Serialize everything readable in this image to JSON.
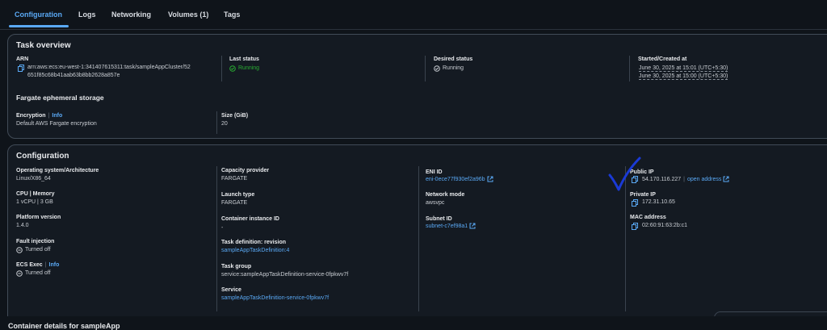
{
  "tabs": [
    "Configuration",
    "Logs",
    "Networking",
    "Volumes (1)",
    "Tags"
  ],
  "task_overview": {
    "title": "Task overview",
    "arn_label": "ARN",
    "arn_line1": "arn:aws:ecs:eu-west-1:341407615311:task/sampleAppCluster/52",
    "arn_line2": "651f85c68b41aab63b8bb2628a857e",
    "last_status_label": "Last status",
    "last_status_value": "Running",
    "desired_status_label": "Desired status",
    "desired_status_value": "Running",
    "started_label": "Started/Created at",
    "started_value": "June 30, 2025 at 15:01 (UTC+5:30)",
    "created_value": "June 30, 2025 at 15:00 (UTC+5:30)",
    "storage_title": "Fargate ephemeral storage",
    "encryption_label": "Encryption",
    "info": "Info",
    "encryption_value": "Default AWS Fargate encryption",
    "size_label": "Size (GiB)",
    "size_value": "20"
  },
  "configuration": {
    "title": "Configuration",
    "os_label": "Operating system/Architecture",
    "os_value": "Linux/X86_64",
    "cpu_label": "CPU | Memory",
    "cpu_value": "1 vCPU | 3 GB",
    "platform_label": "Platform version",
    "platform_value": "1.4.0",
    "fault_label": "Fault injection",
    "fault_value": "Turned off",
    "ecs_exec_label": "ECS Exec",
    "info": "Info",
    "ecs_exec_value": "Turned off",
    "capacity_label": "Capacity provider",
    "capacity_value": "FARGATE",
    "launch_label": "Launch type",
    "launch_value": "FARGATE",
    "container_instance_label": "Container instance ID",
    "container_instance_value": "-",
    "taskdef_label": "Task definition: revision",
    "taskdef_value": "sampleAppTaskDefinition:4",
    "taskgroup_label": "Task group",
    "taskgroup_value": "service:sampleAppTaskDefinition-service-0fpkwv7f",
    "service_label": "Service",
    "service_value": "sampleAppTaskDefinition-service-0fpkwv7f",
    "eni_label": "ENI ID",
    "eni_value": "eni-0ece77f930ef2a96b",
    "netmode_label": "Network mode",
    "netmode_value": "awsvpc",
    "subnet_label": "Subnet ID",
    "subnet_value": "subnet-c7ef98a1",
    "public_ip_label": "Public IP",
    "public_ip_value": "54.170.116.227",
    "open_address": "open address",
    "private_ip_label": "Private IP",
    "private_ip_value": "172.31.10.65",
    "mac_label": "MAC address",
    "mac_value": "02:60:91:63:2b:c1"
  },
  "footer_section_title": "Container details for sampleApp",
  "colors": {
    "accent": "#5aa9f5",
    "running": "#29ad32",
    "annotation": "#1a3ad6"
  }
}
